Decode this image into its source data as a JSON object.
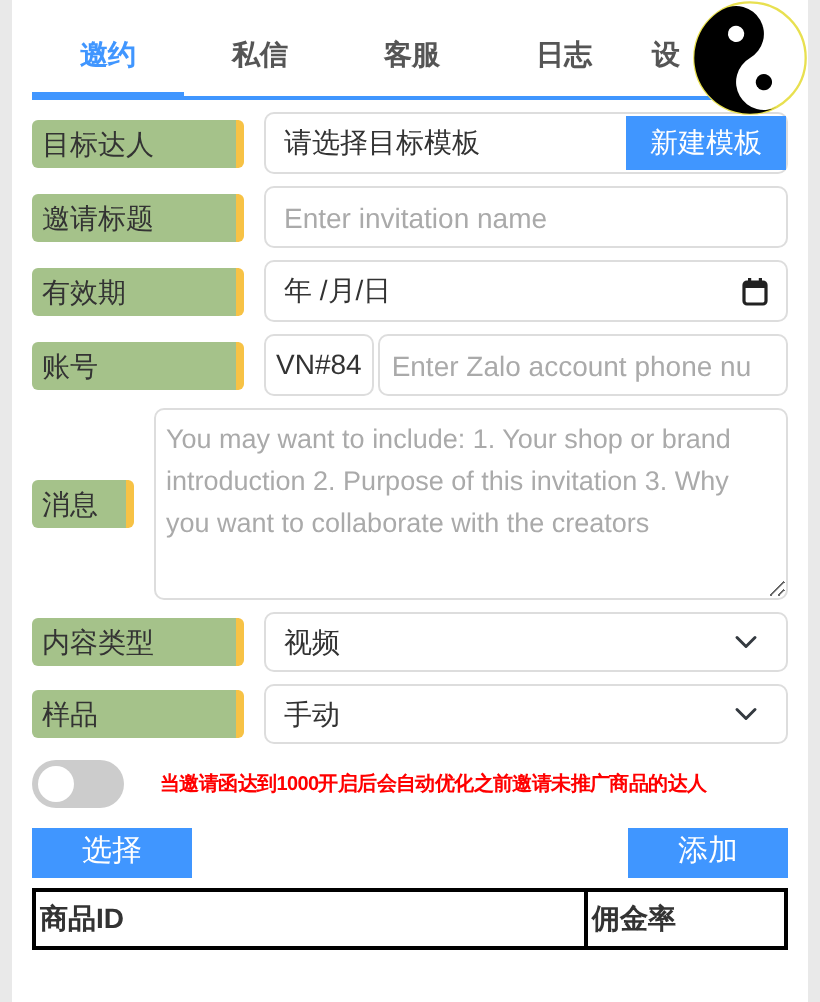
{
  "tabs": [
    {
      "label": "邀约",
      "selected": true
    },
    {
      "label": "私信",
      "selected": false
    },
    {
      "label": "客服",
      "selected": false
    },
    {
      "label": "日志",
      "selected": false
    },
    {
      "label": "设",
      "selected": false
    }
  ],
  "form": [
    {
      "kind": "picker",
      "label": "目标达人",
      "value": "请选择目标模板",
      "button": "新建模板"
    },
    {
      "kind": "text",
      "label": "邀请标题",
      "placeholder": "Enter invitation name"
    },
    {
      "kind": "date",
      "label": "有效期",
      "value": "年 /月/日"
    },
    {
      "kind": "prefixed",
      "label": "账号",
      "prefix": "VN#84",
      "placeholder": "Enter Zalo account phone nu"
    },
    {
      "kind": "textarea",
      "label": "消息",
      "placeholder": "You may want to include: 1. Your shop or brand introduction 2. Purpose of this invitation 3. Why you want to collaborate with the creators"
    },
    {
      "kind": "select",
      "label": "内容类型",
      "value": "视频"
    },
    {
      "kind": "select",
      "label": "样品",
      "value": "手动"
    }
  ],
  "auto_optimize": {
    "on": false,
    "note": "当邀请函达到1000开启后会自动优化之前邀请未推广商品的达人"
  },
  "buttons": {
    "left": "选择",
    "right": "添加"
  },
  "table": {
    "columns": [
      "商品ID",
      "佣金率"
    ]
  }
}
